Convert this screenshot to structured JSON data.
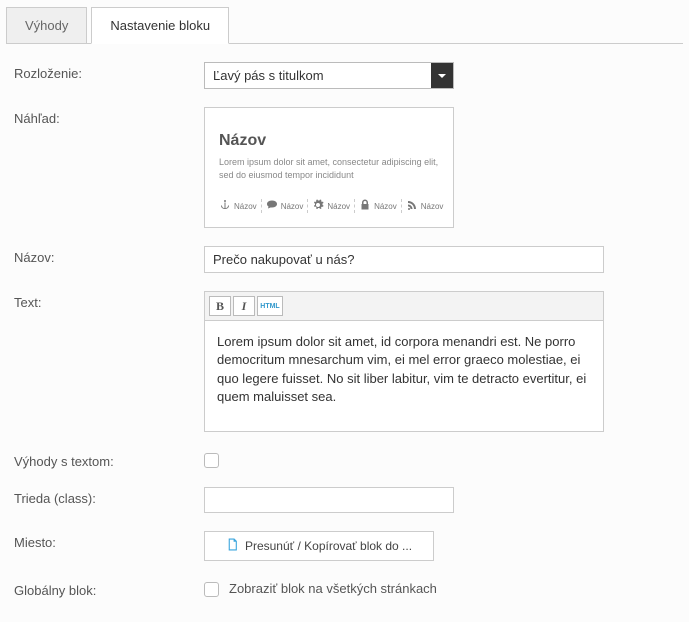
{
  "tabs": {
    "benefits": "Výhody",
    "settings": "Nastavenie bloku"
  },
  "labels": {
    "layout": "Rozloženie:",
    "preview": "Náhľad:",
    "title": "Názov:",
    "text": "Text:",
    "benefits_with_text": "Výhody s textom:",
    "css_class": "Trieda (class):",
    "place": "Miesto:",
    "global_block": "Globálny blok:"
  },
  "layout_select": {
    "selected": "Ľavý pás s titulkom"
  },
  "preview": {
    "title": "Názov",
    "desc": "Lorem ipsum dolor sit amet, consectetur adipiscing elit, sed do eiusmod tempor incididunt",
    "item_label": "Názov"
  },
  "fields": {
    "title_value": "Prečo nakupovať u nás?",
    "text_value": "Lorem ipsum dolor sit amet, id corpora menandri est. Ne porro democritum mnesarchum vim, ei mel error graeco molestiae, ei quo legere fuisset. No sit liber labitur, vim te detracto evertitur, ei quem maluisset sea.",
    "class_value": ""
  },
  "toolbar": {
    "bold": "B",
    "italic": "I",
    "html": "HTML"
  },
  "move_button": "Presunúť / Kopírovať blok do ...",
  "global_checkbox_label": "Zobraziť blok na všetkých stránkach"
}
